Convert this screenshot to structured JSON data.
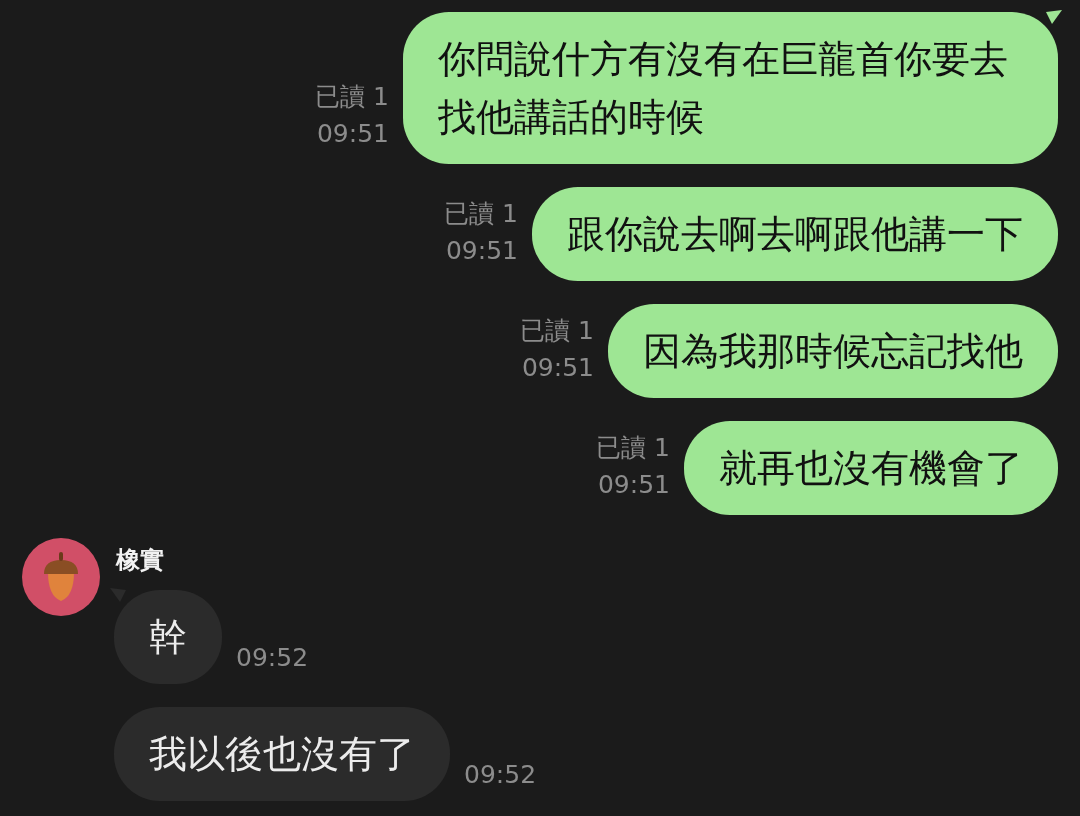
{
  "messages": [
    {
      "kind": "outgoing",
      "tail": true,
      "text": "你問說什方有沒有在巨龍首你要去找他講話的時候",
      "read": "已讀 1",
      "time": "09:51"
    },
    {
      "kind": "outgoing",
      "tail": false,
      "text": "跟你說去啊去啊跟他講一下",
      "read": "已讀 1",
      "time": "09:51"
    },
    {
      "kind": "outgoing",
      "tail": false,
      "text": "因為我那時候忘記找他",
      "read": "已讀 1",
      "time": "09:51"
    },
    {
      "kind": "outgoing",
      "tail": false,
      "text": "就再也沒有機會了",
      "read": "已讀 1",
      "time": "09:51"
    },
    {
      "kind": "incoming",
      "tail": true,
      "sender": "橡實",
      "text": "幹",
      "time": "09:52"
    },
    {
      "kind": "incoming",
      "tail": false,
      "text": "我以後也沒有了",
      "time": "09:52"
    }
  ]
}
